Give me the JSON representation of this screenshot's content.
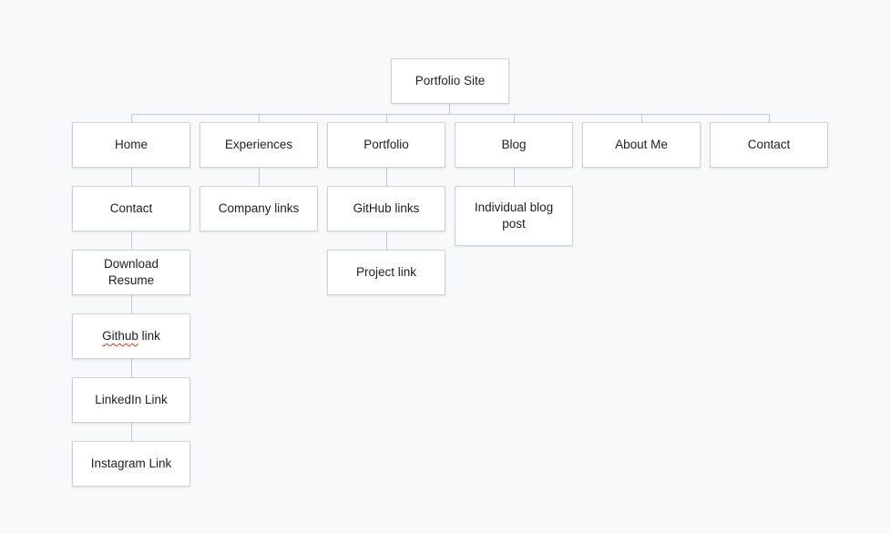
{
  "diagram": {
    "root": {
      "label": "Portfolio Site"
    },
    "sections": [
      {
        "label": "Home",
        "children": [
          {
            "label": "Contact"
          },
          {
            "label": "Download Resume"
          },
          {
            "label_spelled": "Github",
            "label_rest": " link"
          },
          {
            "label": "LinkedIn Link"
          },
          {
            "label": "Instagram Link"
          }
        ]
      },
      {
        "label": "Experiences",
        "children": [
          {
            "label": "Company links"
          }
        ]
      },
      {
        "label": "Portfolio",
        "children": [
          {
            "label": "GitHub links"
          },
          {
            "label": "Project link"
          }
        ]
      },
      {
        "label": "Blog",
        "children": [
          {
            "label": "Individual blog post"
          }
        ]
      },
      {
        "label": "About Me",
        "children": []
      },
      {
        "label": "Contact",
        "children": []
      }
    ]
  },
  "colors": {
    "background": "#f8f9fb",
    "node_border": "#cfd2d6",
    "connector": "#c6c9cd",
    "spellcheck": "#d6362d"
  }
}
